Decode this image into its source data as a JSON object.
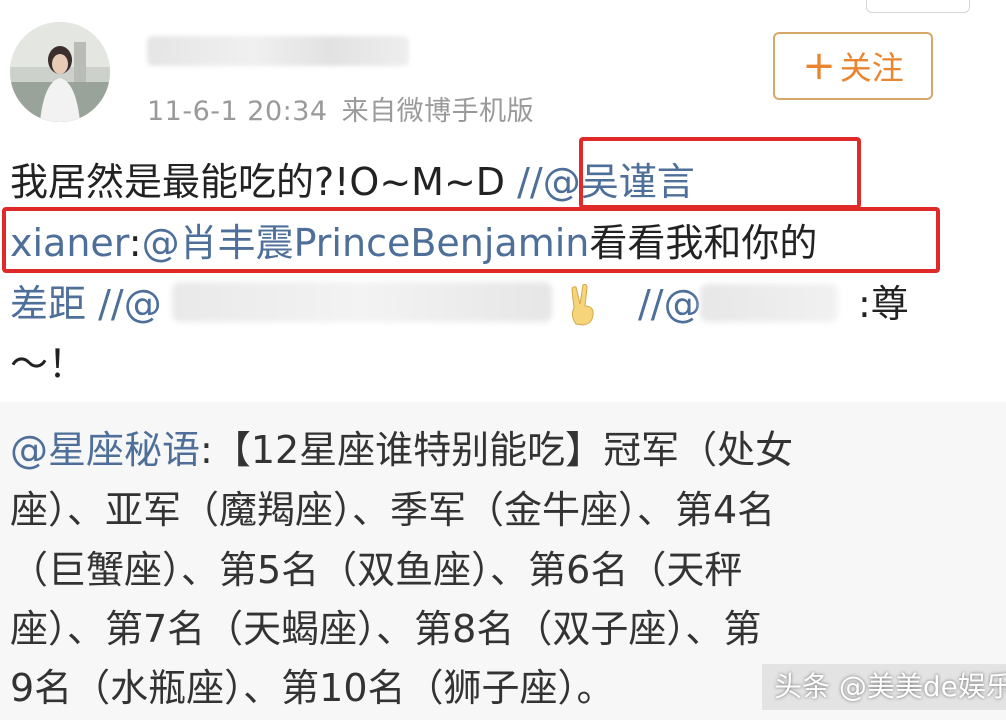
{
  "post": {
    "timestamp": "11-6-1 20:34",
    "source": "来自微博手机版",
    "follow_label": "关注",
    "text": {
      "line1_plain": "我居然是最能吃的?!O~M~D ",
      "line1_mention": "//@吴谨言",
      "line2_mention": "xianer",
      "line2_colon": ":",
      "line2_mention2": "@肖丰震PrinceBenjamin",
      "line2_plain": "看看我和你的",
      "line3_plain": "差距 ",
      "line3_mention_a": "//@",
      "line3_mention_b": "//@",
      "line3_plain_end": ":尊",
      "line4_plain": "～！"
    }
  },
  "quoted": {
    "author": "@星座秘语",
    "line1_rest": ":【12星座谁特别能吃】冠军（处女",
    "line2": "座）、亚军（魔羯座）、季军（金牛座）、第4名",
    "line3": "（巨蟹座）、第5名（双鱼座）、第6名（天秤",
    "line4": "座）、第7名（天蝎座）、第8名（双子座）、第",
    "line5": "9名（水瓶座）、第10名（狮子座）。"
  },
  "watermark": "头条 @美美de娱乐",
  "colors": {
    "mention": "#4d6f99",
    "follow_border": "#d7a86a",
    "follow_text": "#e8852e",
    "highlight": "#e02a2a",
    "meta_text": "#9a9a9a"
  },
  "icons": {
    "follow": "plus-icon",
    "emoji": "victory-hand-emoji"
  }
}
